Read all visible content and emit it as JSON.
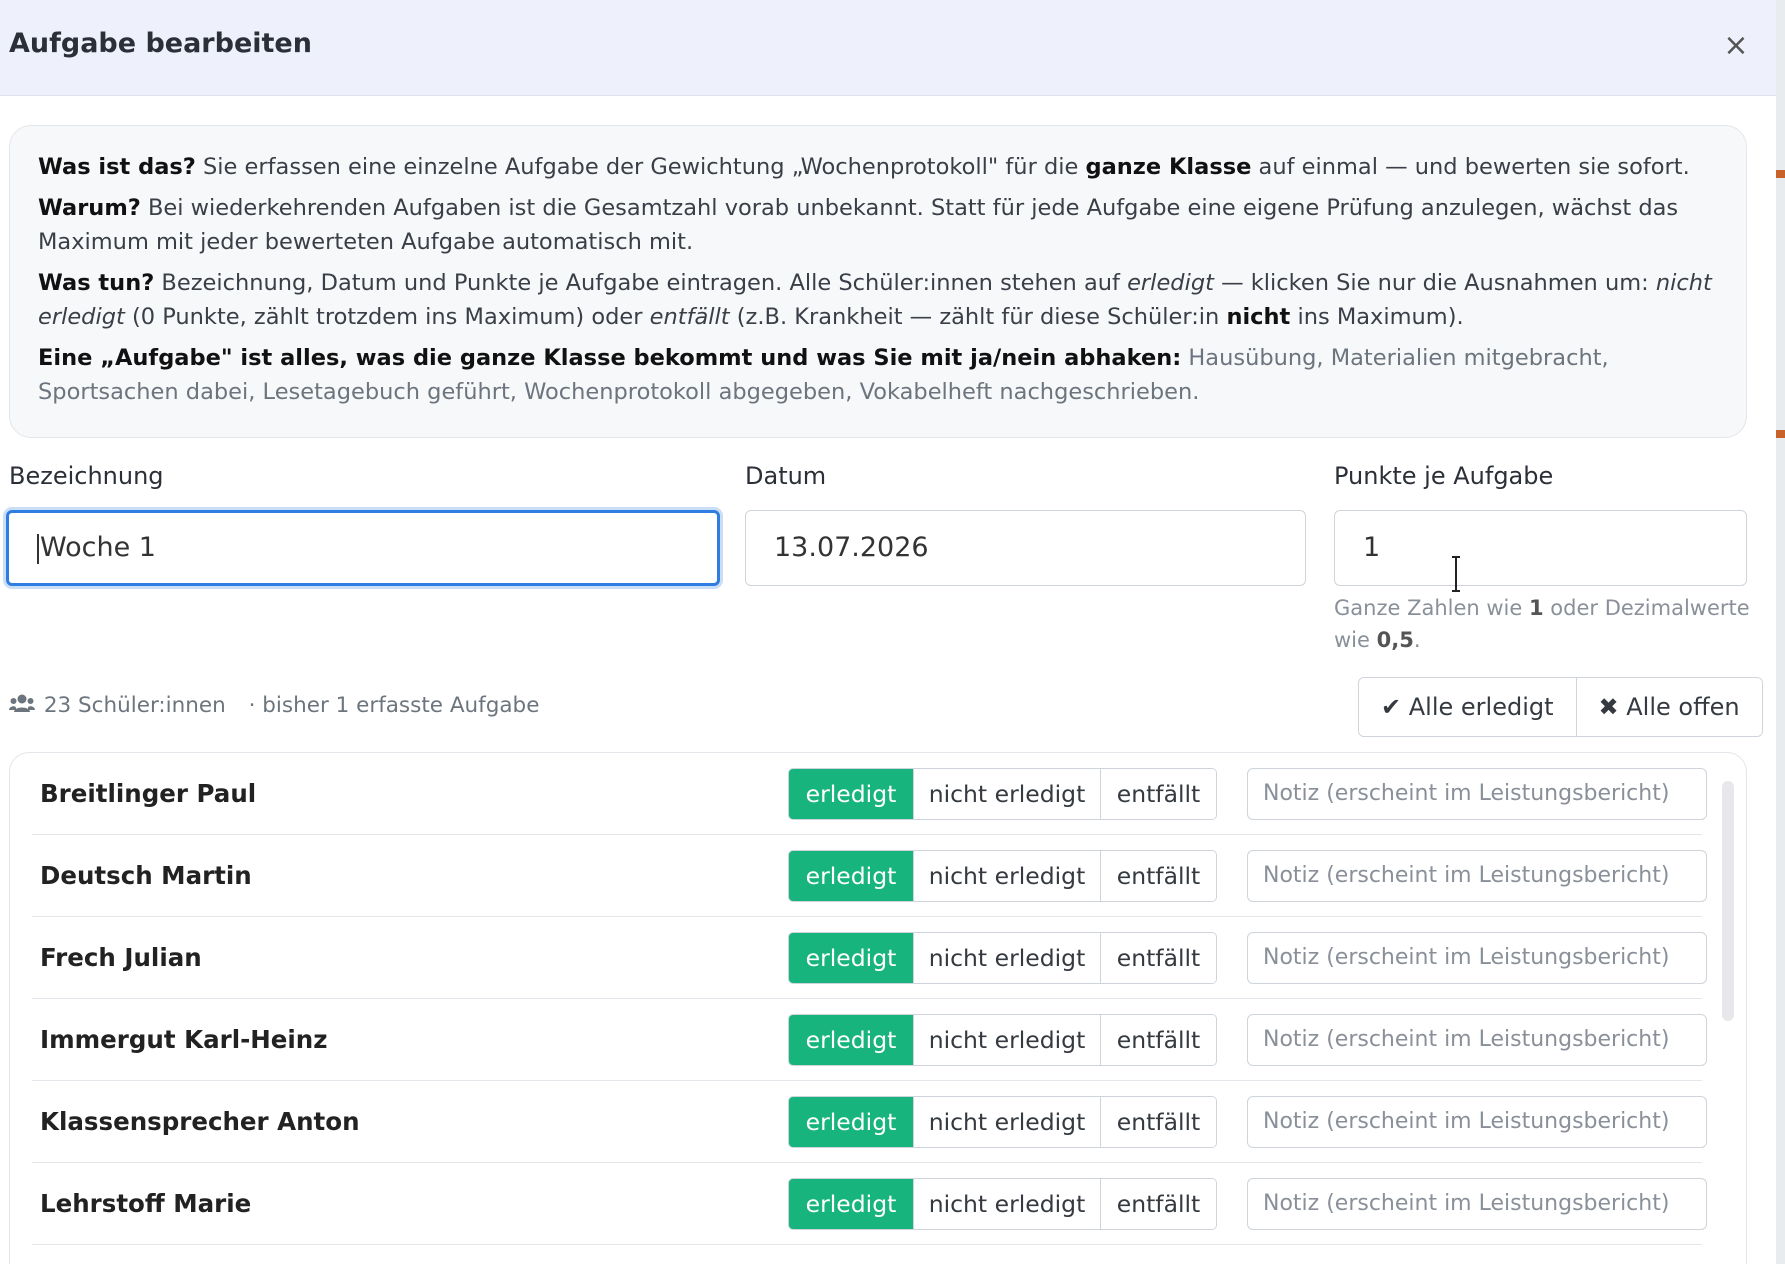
{
  "modal": {
    "title": "Aufgabe bearbeiten",
    "close_label": "×"
  },
  "info": {
    "p1_b1": "Was ist das?",
    "p1_t1": " Sie erfassen eine einzelne Aufgabe der Gewichtung „Wochenprotokoll\" für die ",
    "p1_b2": "ganze Klasse",
    "p1_t2": " auf einmal — und bewerten sie sofort.",
    "p2_b1": "Warum?",
    "p2_t1": " Bei wiederkehrenden Aufgaben ist die Gesamtzahl vorab unbekannt. Statt für jede Aufgabe eine eigene Prüfung anzulegen, wächst das Maximum mit jeder bewerteten Aufgabe automatisch mit.",
    "p3_b1": "Was tun?",
    "p3_t1": " Bezeichnung, Datum und Punkte je Aufgabe eintragen. Alle Schüler:innen stehen auf ",
    "p3_i1": "erledigt",
    "p3_t2": " — klicken Sie nur die Ausnahmen um: ",
    "p3_i2": "nicht erledigt",
    "p3_t3": " (0 Punkte, zählt trotzdem ins Maximum) oder ",
    "p3_i3": "entfällt",
    "p3_t4": " (z.B. Krankheit — zählt für diese Schüler:in ",
    "p3_b2": "nicht",
    "p3_t5": " ins Maximum).",
    "p4_b1": "Eine „Aufgabe\" ist alles, was die ganze Klasse bekommt und was Sie mit ja/nein abhaken:",
    "p4_t1": " Hausübung, Materialien mitgebracht, Sportsachen dabei, Lesetagebuch geführt, Wochenprotokoll abgegeben, Vokabelheft nachgeschrieben."
  },
  "form": {
    "bezeichnung_label": "Bezeichnung",
    "bezeichnung_value": "Woche 1",
    "datum_label": "Datum",
    "datum_value": "13.07.2026",
    "punkte_label": "Punkte je Aufgabe",
    "punkte_value": "1",
    "hint_t1": "Ganze Zahlen wie ",
    "hint_b1": "1",
    "hint_t2": " oder Dezimalwerte wie ",
    "hint_b2": "0,5",
    "hint_t3": "."
  },
  "summary": {
    "students": "23 Schüler:innen",
    "tasks": "· bisher 1 erfasste Aufgabe",
    "all_done_label": "Alle erledigt",
    "all_open_label": "Alle offen"
  },
  "status_options": {
    "done": "erledigt",
    "not_done": "nicht erledigt",
    "excused": "entfällt"
  },
  "note_placeholder": "Notiz (erscheint im Leistungsbericht)",
  "students": [
    {
      "name": "Breitlinger Paul",
      "status": "erledigt"
    },
    {
      "name": "Deutsch Martin",
      "status": "erledigt"
    },
    {
      "name": "Frech Julian",
      "status": "erledigt"
    },
    {
      "name": "Immergut Karl-Heinz",
      "status": "erledigt"
    },
    {
      "name": "Klassensprecher Anton",
      "status": "erledigt"
    },
    {
      "name": "Lehrstoff Marie",
      "status": "erledigt"
    }
  ],
  "colors": {
    "accent_green": "#18b47e",
    "focus_blue": "#2f7de1",
    "header_bg": "#eef0fb"
  }
}
